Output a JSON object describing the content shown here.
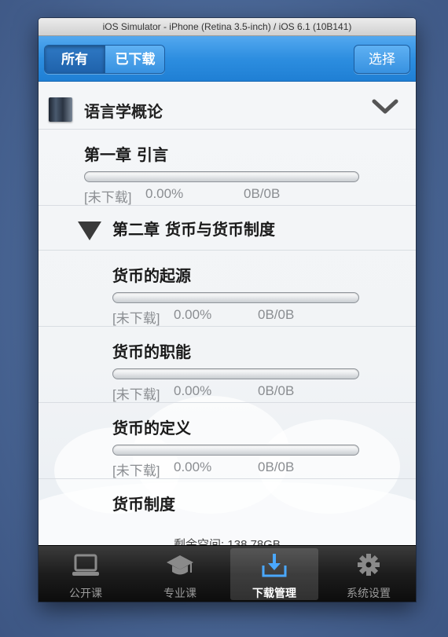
{
  "window": {
    "title": "iOS Simulator - iPhone (Retina 3.5-inch) / iOS 6.1 (10B141)"
  },
  "navbar": {
    "segments": [
      "所有",
      "已下载"
    ],
    "selected_segment": "所有",
    "select_label": "选择"
  },
  "book": {
    "title": "语言学概论",
    "expanded": true
  },
  "items": [
    {
      "title": "第一章 引言",
      "status": "[未下载]",
      "percent": "0.00%",
      "size": "0B/0B",
      "progress": 0
    },
    {
      "title": "第二章 货币与货币制度",
      "is_section": true
    },
    {
      "title": "货币的起源",
      "status": "[未下载]",
      "percent": "0.00%",
      "size": "0B/0B",
      "progress": 0
    },
    {
      "title": "货币的职能",
      "status": "[未下载]",
      "percent": "0.00%",
      "size": "0B/0B",
      "progress": 0
    },
    {
      "title": "货币的定义",
      "status": "[未下载]",
      "percent": "0.00%",
      "size": "0B/0B",
      "progress": 0
    },
    {
      "title": "货币制度"
    }
  ],
  "footer": {
    "storage_text": "剩余空间: 138.78GB"
  },
  "tabbar": {
    "tabs": [
      {
        "label": "公开课",
        "icon": "laptop-icon"
      },
      {
        "label": "专业课",
        "icon": "graduation-cap-icon"
      },
      {
        "label": "下载管理",
        "icon": "download-icon"
      },
      {
        "label": "系统设置",
        "icon": "gear-icon"
      }
    ],
    "active_tab": "下载管理"
  },
  "colors": {
    "nav_blue": "#2d8ee0",
    "active_tab_icon": "#4aa8ff",
    "tabbar": "#1c1c1c"
  }
}
